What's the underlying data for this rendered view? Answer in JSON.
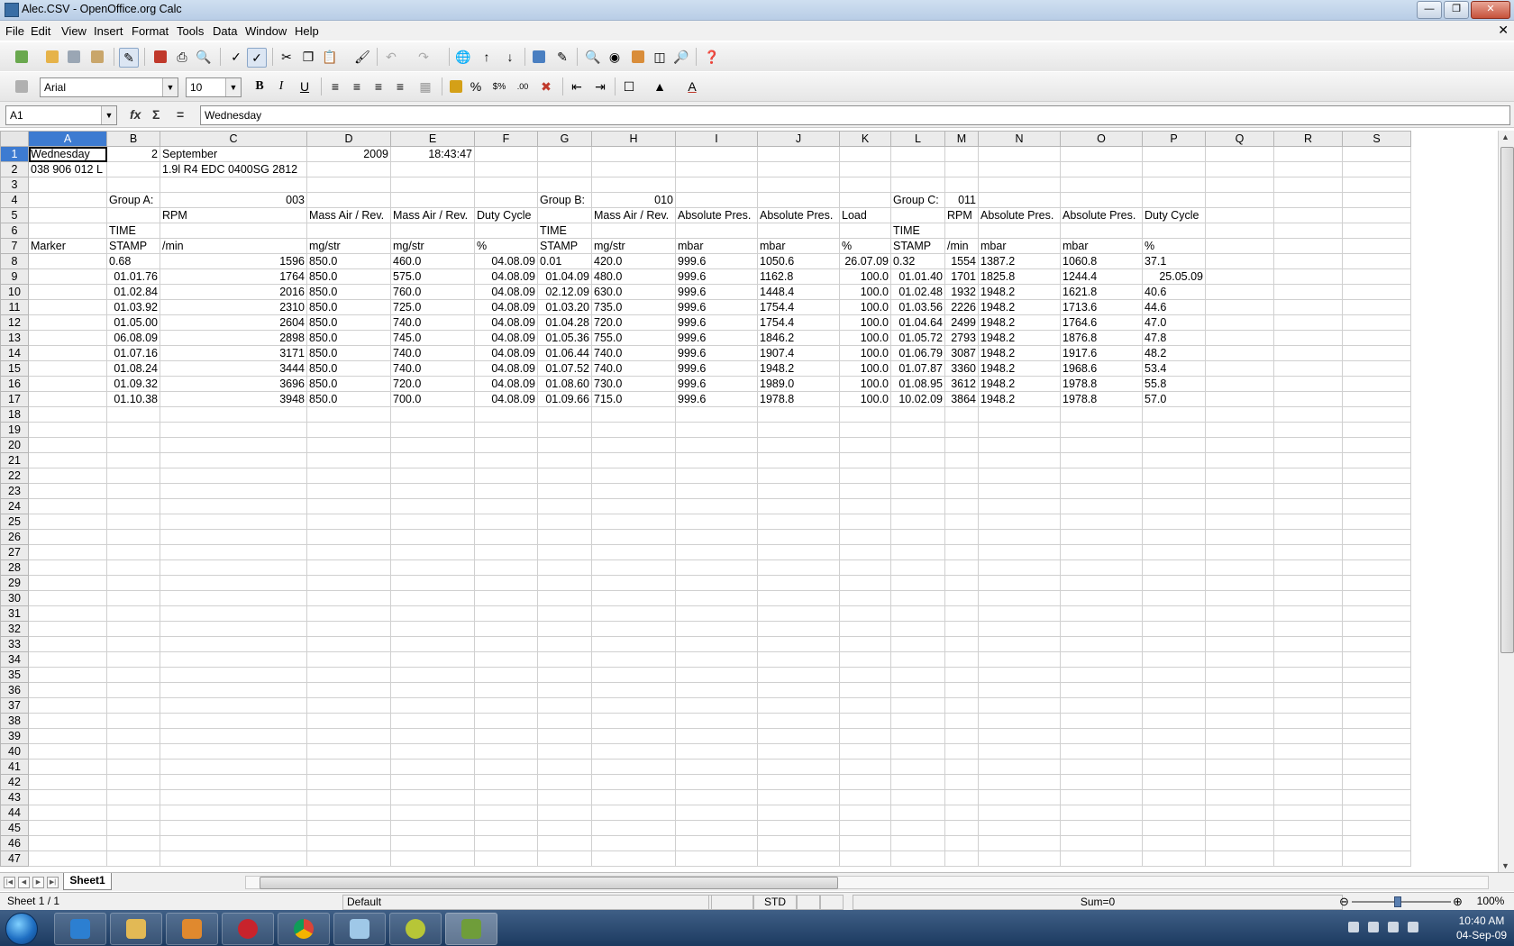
{
  "window": {
    "title": "Alec.CSV - OpenOffice.org Calc"
  },
  "menu": [
    "File",
    "Edit",
    "View",
    "Insert",
    "Format",
    "Tools",
    "Data",
    "Window",
    "Help"
  ],
  "format_toolbar": {
    "font_name": "Arial",
    "font_size": "10"
  },
  "formula_bar": {
    "cell_ref": "A1",
    "content": "Wednesday"
  },
  "columns": [
    "A",
    "B",
    "C",
    "D",
    "E",
    "F",
    "G",
    "H",
    "I",
    "J",
    "K",
    "L",
    "M",
    "N",
    "O",
    "P",
    "Q",
    "R",
    "S"
  ],
  "row_numbers": [
    "1",
    "2",
    "3",
    "4",
    "5",
    "6",
    "7",
    "8",
    "9",
    "10",
    "11",
    "12",
    "13",
    "14",
    "15",
    "16",
    "17",
    "18",
    "19",
    "20",
    "21",
    "22",
    "23",
    "24",
    "25",
    "26",
    "27",
    "28",
    "29",
    "30",
    "31",
    "32",
    "33",
    "34",
    "35",
    "36",
    "37",
    "38",
    "39",
    "40",
    "41",
    "42",
    "43",
    "44",
    "45",
    "46",
    "47"
  ],
  "cells": [
    [
      "Wednesday",
      "2",
      "September",
      "2009",
      "18:43:47",
      "",
      "",
      "",
      "",
      "",
      "",
      "",
      "",
      "",
      "",
      "",
      "",
      "",
      ""
    ],
    [
      "038 906 012 L",
      "",
      " 1.9l R4 EDC 0400SG  2812",
      "",
      "",
      "",
      "",
      "",
      "",
      "",
      "",
      "",
      "",
      "",
      "",
      "",
      "",
      "",
      ""
    ],
    [
      "",
      "",
      "",
      "",
      "",
      "",
      "",
      "",
      "",
      "",
      "",
      "",
      "",
      "",
      "",
      "",
      "",
      "",
      ""
    ],
    [
      "",
      "Group A:",
      "003",
      "",
      "",
      "",
      "Group B:",
      "010",
      "",
      "",
      "",
      "Group C:",
      "011",
      "",
      "",
      "",
      "",
      "",
      ""
    ],
    [
      "",
      "",
      "RPM",
      "Mass Air / Rev.",
      "Mass Air / Rev.",
      "Duty Cycle",
      "",
      "Mass Air / Rev.",
      "Absolute Pres.",
      "Absolute Pres.",
      "Load",
      "",
      "RPM",
      "Absolute Pres.",
      "Absolute Pres.",
      "Duty Cycle",
      "",
      "",
      ""
    ],
    [
      "",
      "TIME",
      "",
      "",
      "",
      "",
      "TIME",
      "",
      "",
      "",
      "",
      "TIME",
      "",
      "",
      "",
      "",
      "",
      "",
      ""
    ],
    [
      "Marker",
      "STAMP",
      " /min",
      " mg/str",
      " mg/str",
      " %",
      "STAMP",
      " mg/str",
      " mbar",
      " mbar",
      " %",
      "STAMP",
      " /min",
      " mbar",
      " mbar",
      " %",
      "",
      "",
      ""
    ],
    [
      "",
      "0.68",
      "1596",
      "850.0",
      "460.0",
      "04.08.09",
      "0.01",
      "420.0",
      "999.6",
      "1050.6",
      "26.07.09",
      "0.32",
      "1554",
      "1387.2",
      "1060.8",
      "37.1",
      "",
      "",
      ""
    ],
    [
      "",
      "01.01.76",
      "1764",
      "850.0",
      "575.0",
      "04.08.09",
      "01.04.09",
      "480.0",
      "999.6",
      "1162.8",
      "100.0",
      "01.01.40",
      "1701",
      "1825.8",
      "1244.4",
      "25.05.09",
      "",
      "",
      ""
    ],
    [
      "",
      "01.02.84",
      "2016",
      "850.0",
      "760.0",
      "04.08.09",
      "02.12.09",
      "630.0",
      "999.6",
      "1448.4",
      "100.0",
      "01.02.48",
      "1932",
      "1948.2",
      "1621.8",
      "40.6",
      "",
      "",
      ""
    ],
    [
      "",
      "01.03.92",
      "2310",
      "850.0",
      "725.0",
      "04.08.09",
      "01.03.20",
      "735.0",
      "999.6",
      "1754.4",
      "100.0",
      "01.03.56",
      "2226",
      "1948.2",
      "1713.6",
      "44.6",
      "",
      "",
      ""
    ],
    [
      "",
      "01.05.00",
      "2604",
      "850.0",
      "740.0",
      "04.08.09",
      "01.04.28",
      "720.0",
      "999.6",
      "1754.4",
      "100.0",
      "01.04.64",
      "2499",
      "1948.2",
      "1764.6",
      "47.0",
      "",
      "",
      ""
    ],
    [
      "",
      "06.08.09",
      "2898",
      "850.0",
      "745.0",
      "04.08.09",
      "01.05.36",
      "755.0",
      "999.6",
      "1846.2",
      "100.0",
      "01.05.72",
      "2793",
      "1948.2",
      "1876.8",
      "47.8",
      "",
      "",
      ""
    ],
    [
      "",
      "01.07.16",
      "3171",
      "850.0",
      "740.0",
      "04.08.09",
      "01.06.44",
      "740.0",
      "999.6",
      "1907.4",
      "100.0",
      "01.06.79",
      "3087",
      "1948.2",
      "1917.6",
      "48.2",
      "",
      "",
      ""
    ],
    [
      "",
      "01.08.24",
      "3444",
      "850.0",
      "740.0",
      "04.08.09",
      "01.07.52",
      "740.0",
      "999.6",
      "1948.2",
      "100.0",
      "01.07.87",
      "3360",
      "1948.2",
      "1968.6",
      "53.4",
      "",
      "",
      ""
    ],
    [
      "",
      "01.09.32",
      "3696",
      "850.0",
      "720.0",
      "04.08.09",
      "01.08.60",
      "730.0",
      "999.6",
      "1989.0",
      "100.0",
      "01.08.95",
      "3612",
      "1948.2",
      "1978.8",
      "55.8",
      "",
      "",
      ""
    ],
    [
      "",
      "01.10.38",
      "3948",
      "850.0",
      "700.0",
      "04.08.09",
      "01.09.66",
      "715.0",
      "999.6",
      "1978.8",
      "100.0",
      "10.02.09",
      "3864",
      "1948.2",
      "1978.8",
      "57.0",
      "",
      "",
      ""
    ]
  ],
  "sheet_tabs": [
    "Sheet1"
  ],
  "status": {
    "sheet": "Sheet 1 / 1",
    "style": "Default",
    "mode": "STD",
    "sum": "Sum=0",
    "zoom": "100%"
  },
  "taskbar": {
    "time": "10:40 AM",
    "date": "04-Sep-09"
  },
  "colors": {
    "selection": "#3d7bd1",
    "taskbar": "#1c3a60"
  }
}
